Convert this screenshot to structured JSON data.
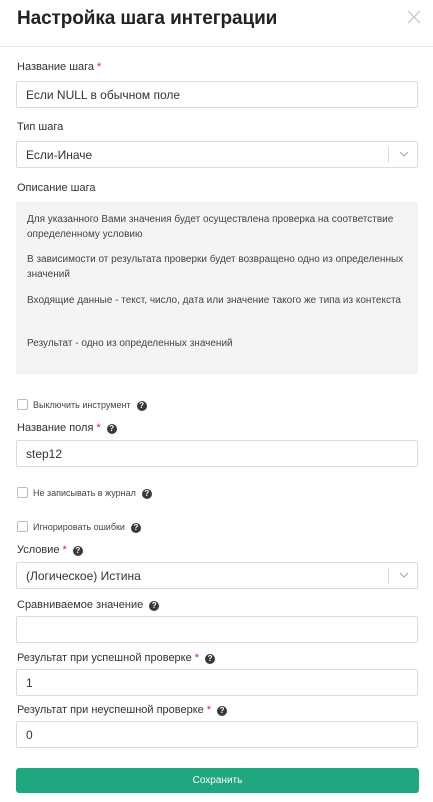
{
  "dialog": {
    "title": "Настройка шага интеграции"
  },
  "step_name": {
    "label": "Название шага",
    "value": "Если NULL в обычном поле"
  },
  "step_type": {
    "label": "Тип шага",
    "value": "Если-Иначе"
  },
  "description": {
    "label": "Описание шага",
    "paragraphs": [
      "Для указанного Вами значения будет осуществлена проверка на соответствие определенному условию",
      "В зависимости от результата проверки будет возвращено одно из определенных значений",
      "Входящие данные - текст, число, дата или значение такого же типа из контекста",
      "Результат - одно из определенных значений"
    ]
  },
  "disable_tool": {
    "label": "Выключить инструмент",
    "checked": false
  },
  "field_name": {
    "label": "Название поля",
    "value": "step12"
  },
  "no_log": {
    "label": "Не записывать в журнал",
    "checked": false
  },
  "ignore_errors": {
    "label": "Игнорировать ошибки",
    "checked": false
  },
  "condition": {
    "label": "Условие",
    "value": "(Логическое) Истина"
  },
  "compare_value": {
    "label": "Сравниваемое значение",
    "value": ""
  },
  "success_result": {
    "label": "Результат при успешной проверке",
    "value": "1"
  },
  "fail_result": {
    "label": "Результат при неуспешной проверке",
    "value": "0"
  },
  "save_label": "Сохранить",
  "required_mark": "*",
  "help_glyph": "?",
  "colors": {
    "accent": "#20a77f",
    "required": "#e02424",
    "desc_bg": "#f4f4f4"
  }
}
